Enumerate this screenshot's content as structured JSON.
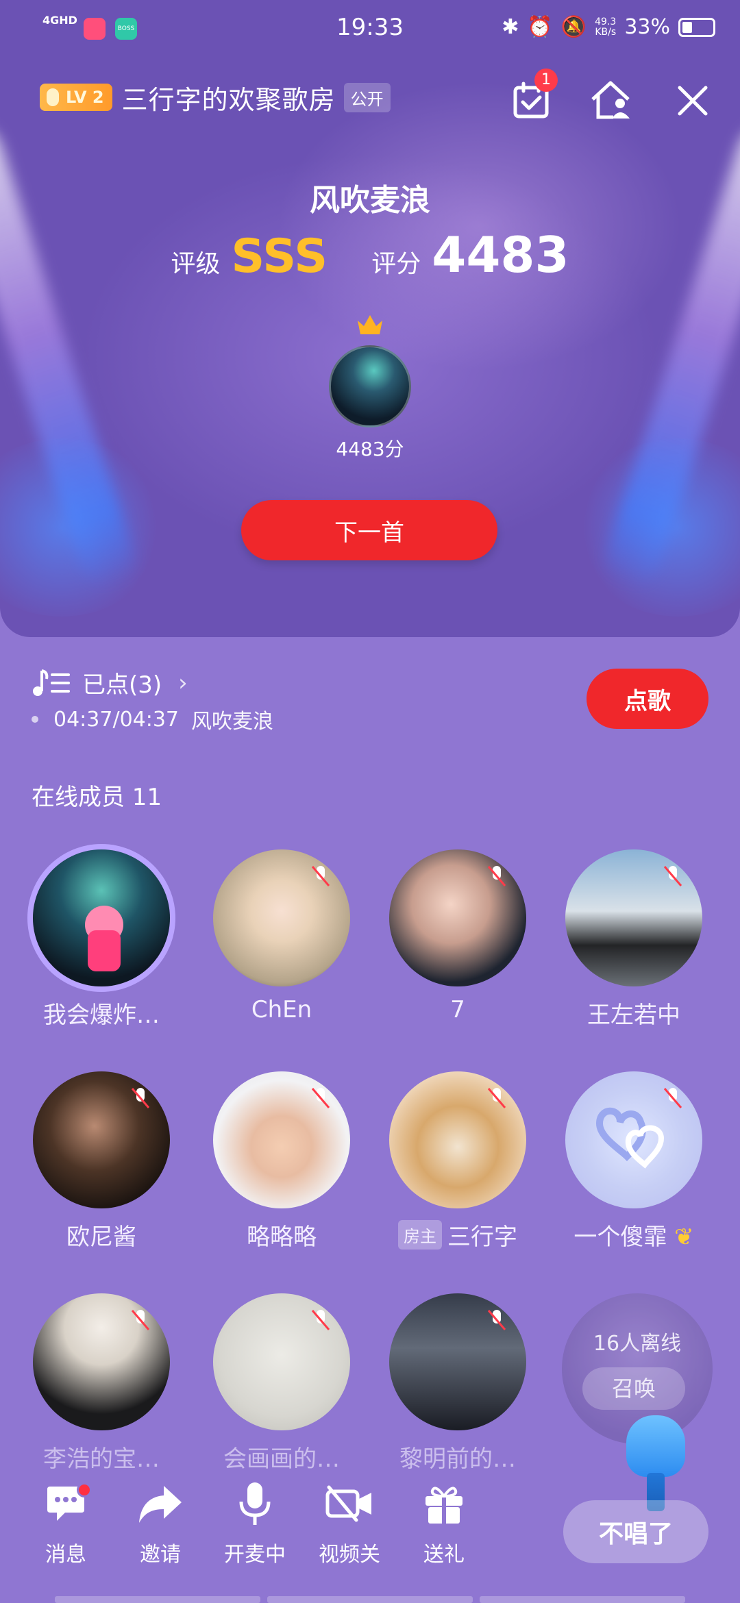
{
  "status_bar": {
    "network": "4GHD",
    "time": "19:33",
    "speed": "49.3\nKB/s",
    "battery": "33%",
    "app2_label": "BOSS"
  },
  "room": {
    "level": "LV 2",
    "title": "三行字的欢聚歌房",
    "visibility": "公开",
    "calendar_badge": "1"
  },
  "song": {
    "title": "风吹麦浪",
    "grade_label": "评级",
    "grade": "SSS",
    "score_label": "评分",
    "score": "4483",
    "singer_score": "4483分"
  },
  "next_button": "下一首",
  "queue": {
    "label": "已点(3)",
    "time": "04:37/04:37",
    "current_song": "风吹麦浪",
    "request_button": "点歌"
  },
  "members": {
    "title": "在线成员 11",
    "list": [
      {
        "name": "我会爆炸…"
      },
      {
        "name": "ChEn"
      },
      {
        "name": "7"
      },
      {
        "name": "王左若中"
      },
      {
        "name": "欧尼酱"
      },
      {
        "name": "略略略"
      },
      {
        "name": "三行字",
        "tag": "房主"
      },
      {
        "name": "一个傻霏"
      },
      {
        "name": "李浩的宝…"
      },
      {
        "name": "会画画的…"
      },
      {
        "name": "黎明前的…"
      }
    ],
    "offline_text": "16人离线",
    "summon_button": "召唤"
  },
  "toolbar": {
    "messages": "消息",
    "invite": "邀请",
    "mic": "开麦中",
    "video": "视频关",
    "gift": "送礼",
    "stop_singing": "不唱了"
  },
  "colors": {
    "accent_red": "#f0272b",
    "grade_gold": "#ffbf2a",
    "background": "#8f76d2"
  }
}
